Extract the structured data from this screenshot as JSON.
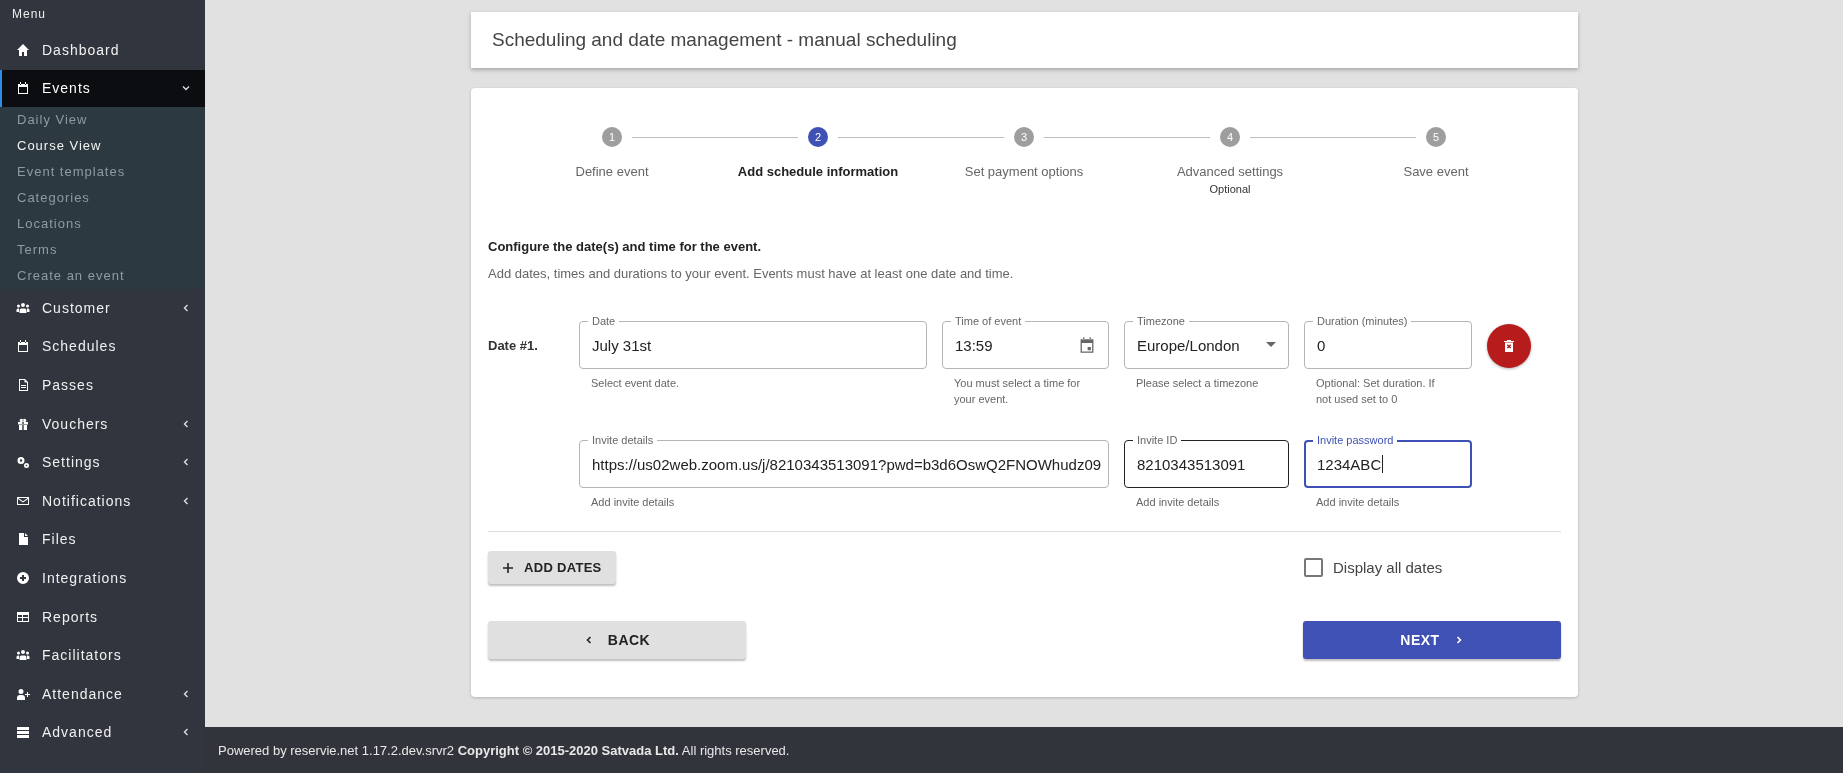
{
  "sidebar": {
    "title": "Menu",
    "items": [
      {
        "label": "Dashboard",
        "selected": false
      },
      {
        "label": "Events",
        "selected": true,
        "expanded": true,
        "children": [
          {
            "label": "Daily View",
            "selected": false
          },
          {
            "label": "Course View",
            "selected": true
          },
          {
            "label": "Event templates",
            "selected": false
          },
          {
            "label": "Categories",
            "selected": false
          },
          {
            "label": "Locations",
            "selected": false
          },
          {
            "label": "Terms",
            "selected": false
          },
          {
            "label": "Create an event",
            "selected": false
          }
        ]
      },
      {
        "label": "Customer",
        "selected": false,
        "expanded": false
      },
      {
        "label": "Schedules",
        "selected": false
      },
      {
        "label": "Passes",
        "selected": false
      },
      {
        "label": "Vouchers",
        "selected": false,
        "expanded": false
      },
      {
        "label": "Settings",
        "selected": false,
        "expanded": false
      },
      {
        "label": "Notifications",
        "selected": false,
        "expanded": false
      },
      {
        "label": "Files",
        "selected": false
      },
      {
        "label": "Integrations",
        "selected": false
      },
      {
        "label": "Reports",
        "selected": false
      },
      {
        "label": "Facilitators",
        "selected": false
      },
      {
        "label": "Attendance",
        "selected": false,
        "expanded": false
      },
      {
        "label": "Advanced",
        "selected": false,
        "expanded": false
      }
    ]
  },
  "header": {
    "title": "Scheduling and date management - manual scheduling"
  },
  "stepper": {
    "steps": [
      {
        "number": "1",
        "label": "Define event",
        "selected": false
      },
      {
        "number": "2",
        "label": "Add schedule information",
        "selected": true
      },
      {
        "number": "3",
        "label": "Set payment options",
        "selected": false
      },
      {
        "number": "4",
        "label": "Advanced settings",
        "selected": false,
        "note": "Optional"
      },
      {
        "number": "5",
        "label": "Save event",
        "selected": false
      }
    ]
  },
  "form": {
    "heading": "Configure the date(s) and time for the event.",
    "description": "Add dates, times and durations to your event. Events must have at least one date and time.",
    "dates": [
      {
        "label": "Date #1.",
        "fields": [
          {
            "kind": "text",
            "label": "Date",
            "value": "July 31st",
            "helper": "Select event date.",
            "focused": false,
            "hovered": false
          },
          {
            "kind": "time",
            "label": "Time of event",
            "value": "13:59",
            "helper": "You must select a time for your event.",
            "focused": false,
            "hovered": false
          },
          {
            "kind": "select",
            "label": "Timezone",
            "value": "Europe/London",
            "helper": "Please select a timezone",
            "focused": false,
            "hovered": false
          },
          {
            "kind": "text",
            "label": "Duration (minutes)",
            "value": "0",
            "helper": "Optional: Set duration. If not used set to 0",
            "focused": false,
            "hovered": false
          }
        ],
        "invite_fields": [
          {
            "kind": "text",
            "label": "Invite details",
            "value": "https://us02web.zoom.us/j/8210343513091?pwd=b3d6OswQ2FNOWhudz09",
            "helper": "Add invite details",
            "focused": false,
            "hovered": false
          },
          {
            "kind": "text",
            "label": "Invite ID",
            "value": "8210343513091",
            "helper": "Add invite details",
            "focused": false,
            "hovered": true
          },
          {
            "kind": "text",
            "label": "Invite password",
            "value": "1234ABC",
            "helper": "Add invite details",
            "focused": true,
            "hovered": false
          }
        ]
      }
    ],
    "add_dates_button": "ADD DATES",
    "display_all_dates": {
      "label": "Display all dates",
      "checked": false
    },
    "back_button": "BACK",
    "next_button": "NEXT"
  },
  "footer": {
    "text": "Powered by reservie.net 1.17.2.dev.srvr2 **Copyright © 2015-2020 Satvada Ltd.** All rights reserved."
  }
}
